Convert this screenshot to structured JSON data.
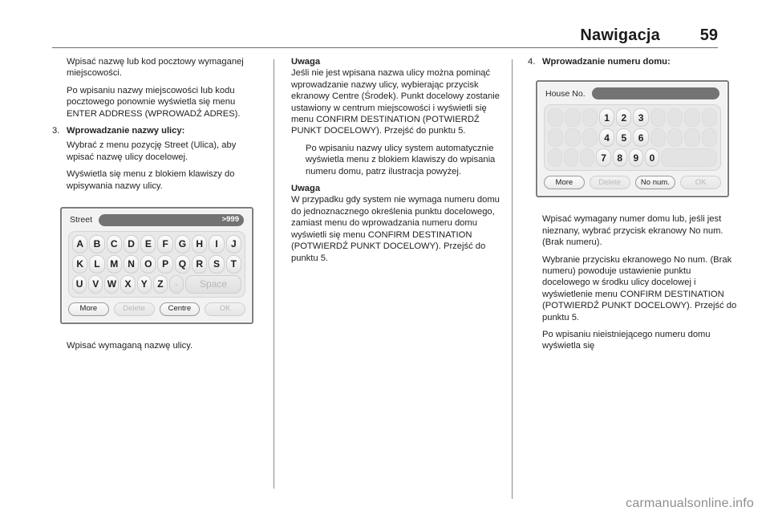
{
  "header": {
    "title": "Nawigacja",
    "page_number": "59"
  },
  "column1": {
    "para1": "Wpisać nazwę lub kod pocztowy wymaganej miejscowości.",
    "para2": "Po wpisaniu nazwy miejscowości lub kodu pocztowego ponownie wyświetla się menu ENTER ADDRESS (WPROWADŹ ADRES).",
    "step3_num": "3.",
    "step3_label": "Wprowadzanie nazwy ulicy:",
    "para3": "Wybrać z menu pozycję Street (Ulica), aby wpisać nazwę ulicy docelowej.",
    "para4": "Wyświetla się menu z blokiem klawiszy do wpisywania nazwy ulicy.",
    "caption": "Wpisać wymaganą nazwę ulicy.",
    "figure": {
      "name": "street-keyboard-screen",
      "field_label": "Street",
      "field_value": ">999",
      "key_rows": [
        [
          "A",
          "B",
          "C",
          "D",
          "E",
          "F",
          "G",
          "H",
          "I",
          "J"
        ],
        [
          "K",
          "L",
          "M",
          "N",
          "O",
          "P",
          "Q",
          "R",
          "S",
          "T"
        ],
        [
          "U",
          "V",
          "W",
          "X",
          "Y",
          "Z",
          "-",
          "Space"
        ]
      ],
      "buttons": [
        {
          "label": "More",
          "state": "enabled"
        },
        {
          "label": "Delete",
          "state": "disabled"
        },
        {
          "label": "Centre",
          "state": "enabled"
        },
        {
          "label": "OK",
          "state": "disabled"
        }
      ]
    }
  },
  "column2": {
    "note1_head": "Uwaga",
    "note1_body": "Jeśli nie jest wpisana nazwa ulicy można pominąć wprowadzanie nazwy ulicy, wybierając przycisk ekranowy Centre (Środek). Punkt docelowy zostanie ustawiony w centrum miejscowości i wyświetli się menu CONFIRM DESTINATION (POTWIERDŹ PUNKT DOCELOWY). Przejść do punktu 5.",
    "para1": "Po wpisaniu nazwy ulicy system automatycznie wyświetla menu z blokiem klawiszy do wpisania numeru domu, patrz ilustracja powyżej.",
    "note2_head": "Uwaga",
    "note2_body": "W przypadku gdy system nie wymaga numeru domu do jednoznacznego określenia punktu docelowego, zamiast menu do wprowadzania numeru domu wyświetli się menu CONFIRM DESTINATION (POTWIERDŹ PUNKT DOCELOWY). Przejść do punktu 5."
  },
  "column3": {
    "step4_num": "4.",
    "step4_label": "Wprowadzanie numeru domu:",
    "para1": "Wpisać wymagany numer domu lub, jeśli jest nieznany, wybrać przycisk ekranowy No num. (Brak numeru).",
    "para2": "Wybranie przycisku ekranowego No num. (Brak numeru) powoduje ustawienie punktu docelowego w środku ulicy docelowej i wyświetlenie menu CONFIRM DESTINATION (POTWIERDŹ PUNKT DOCELOWY). Przejść do punktu 5.",
    "para3": "Po wpisaniu nieistniejącego numeru domu wyświetla się",
    "figure": {
      "name": "house-number-keypad-screen",
      "field_label": "House No.",
      "field_value": "",
      "key_rows": [
        [
          "",
          "",
          "",
          "1",
          "2",
          "3",
          "",
          "",
          "",
          ""
        ],
        [
          "",
          "",
          "",
          "4",
          "5",
          "6",
          "",
          "",
          "",
          ""
        ],
        [
          "",
          "",
          "",
          "7",
          "8",
          "9",
          "0",
          ""
        ]
      ],
      "buttons": [
        {
          "label": "More",
          "state": "enabled"
        },
        {
          "label": "Delete",
          "state": "disabled"
        },
        {
          "label": "No num.",
          "state": "enabled"
        },
        {
          "label": "OK",
          "state": "disabled"
        }
      ]
    }
  },
  "footer": {
    "watermark": "carmanualsonline.info"
  }
}
